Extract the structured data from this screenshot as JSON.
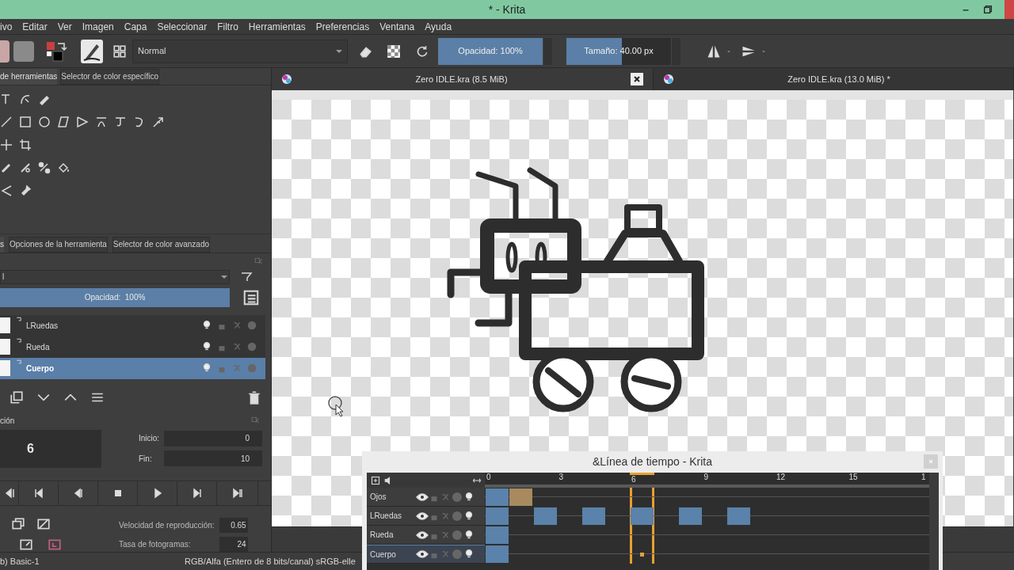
{
  "window": {
    "title": "* - Krita"
  },
  "menu": [
    "ivo",
    "Editar",
    "Ver",
    "Imagen",
    "Capa",
    "Seleccionar",
    "Filtro",
    "Herramientas",
    "Preferencias",
    "Ventana",
    "Ayuda"
  ],
  "toolbar": {
    "blend_mode": "Normal",
    "opacity": {
      "label": "Opacidad: 100%",
      "level": 1
    },
    "size": {
      "label": "Tamaño: 40.00 px",
      "level": 0.53
    }
  },
  "top_dock_tabs": [
    {
      "label": "de herramientas",
      "selected": true
    },
    {
      "label": "Selector de color específico",
      "selected": false
    }
  ],
  "dock_tabs": [
    {
      "label": "s",
      "selected": true
    },
    {
      "label": "Opciones de la herramienta",
      "selected": false
    },
    {
      "label": "Selector de color avanzado",
      "selected": false
    }
  ],
  "layers": {
    "blend_mode": "l",
    "opacity": {
      "label": "Opacidad:  100%",
      "level": 1
    },
    "items": [
      {
        "name": "LRuedas",
        "selected": false
      },
      {
        "name": "Rueda",
        "selected": false
      },
      {
        "name": "Cuerpo",
        "selected": true
      }
    ]
  },
  "animation": {
    "title": "ción",
    "frame": "6",
    "start_label": "Inicio:",
    "start": "0",
    "end_label": "Fin:",
    "end": "10",
    "speed_label": "Velocidad de reproducción:",
    "speed": "0.65",
    "fps_label": "Tasa de fotogramas:",
    "fps": "24"
  },
  "documents": [
    {
      "title": "Zero IDLE.kra (8.5 MiB)",
      "selected": true
    },
    {
      "title": "Zero IDLE.kra (13.0 MiB) *",
      "selected": false
    }
  ],
  "timeline": {
    "title": "&Línea de tiempo - Krita",
    "frames": [
      {
        "label": "0",
        "selected": false
      },
      {
        "selected": false
      },
      {
        "selected": false
      },
      {
        "label": "3",
        "selected": false
      },
      {
        "selected": false
      },
      {
        "selected": false
      },
      {
        "label": "6",
        "selected": true
      },
      {
        "selected": false
      },
      {
        "selected": false
      },
      {
        "label": "9",
        "selected": false
      },
      {
        "selected": false
      },
      {
        "selected": false
      },
      {
        "label": "12",
        "selected": false
      },
      {
        "selected": false
      },
      {
        "selected": false
      },
      {
        "label": "15",
        "selected": false
      },
      {
        "selected": false
      },
      {
        "selected": false
      },
      {
        "label": "1",
        "selected": false
      }
    ],
    "layers": [
      {
        "name": "Ojos",
        "selected": false,
        "cells": [
          {
            "kind": "key",
            "color": "#5a82aa"
          },
          {
            "kind": "key",
            "color": "#a88a5e"
          }
        ]
      },
      {
        "name": "LRuedas",
        "selected": false,
        "cells": [
          {
            "kind": "key",
            "color": "#5a82aa"
          },
          {
            "kind": "empty"
          },
          {
            "kind": "key",
            "color": "#5a82aa"
          },
          {
            "kind": "empty"
          },
          {
            "kind": "key",
            "color": "#5a82aa"
          },
          {
            "kind": "empty"
          },
          {
            "kind": "key",
            "color": "#5a82aa"
          },
          {
            "kind": "empty"
          },
          {
            "kind": "key",
            "color": "#5a82aa"
          },
          {
            "kind": "empty"
          },
          {
            "kind": "key",
            "color": "#5a82aa"
          }
        ]
      },
      {
        "name": "Rueda",
        "selected": false,
        "cells": [
          {
            "kind": "key",
            "color": "#5a82aa"
          }
        ]
      },
      {
        "name": "Cuerpo",
        "selected": true,
        "cells": [
          {
            "kind": "key",
            "color": "#5a82aa"
          },
          {
            "kind": "empty"
          },
          {
            "kind": "empty"
          },
          {
            "kind": "empty"
          },
          {
            "kind": "empty"
          },
          {
            "kind": "empty"
          },
          {
            "kind": "dot",
            "color": "#e0a040"
          }
        ]
      }
    ]
  },
  "status_bar": {
    "brush": "b) Basic-1",
    "color_space": "RGB/Alfa (Entero de 8 bits/canal)  sRGB-elle"
  }
}
